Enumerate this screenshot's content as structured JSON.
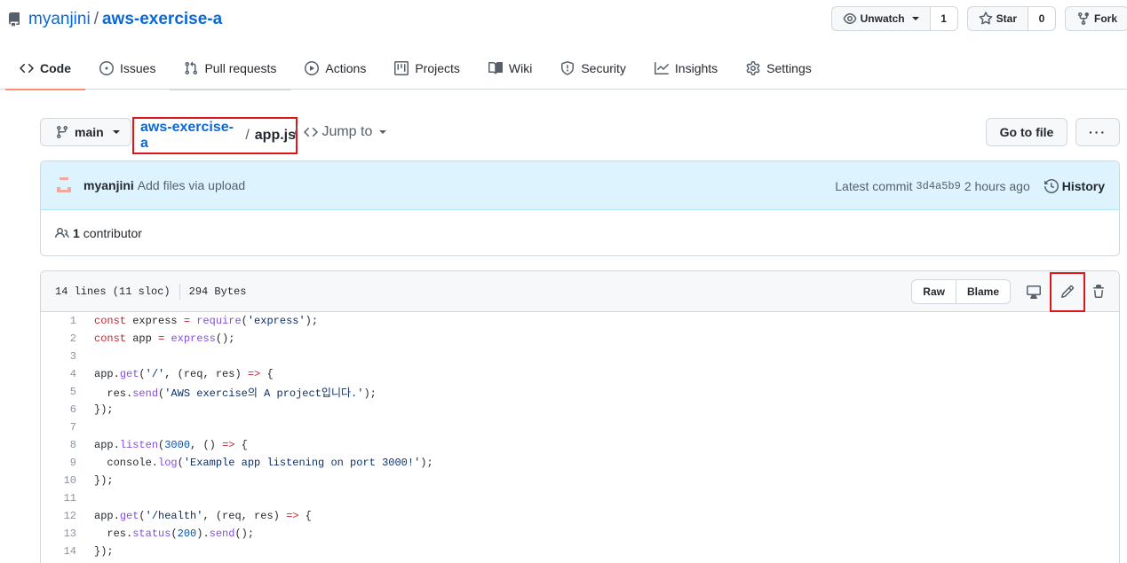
{
  "repo": {
    "owner": "myanjini",
    "separator": "/",
    "name": "aws-exercise-a"
  },
  "repo_actions": {
    "watch": {
      "label": "Unwatch",
      "count": "1"
    },
    "star": {
      "label": "Star",
      "count": "0"
    },
    "fork": {
      "label": "Fork"
    }
  },
  "tabs": [
    {
      "label": "Code",
      "icon": "code-icon"
    },
    {
      "label": "Issues",
      "icon": "issue-icon"
    },
    {
      "label": "Pull requests",
      "icon": "pull-request-icon"
    },
    {
      "label": "Actions",
      "icon": "play-icon"
    },
    {
      "label": "Projects",
      "icon": "project-icon"
    },
    {
      "label": "Wiki",
      "icon": "book-icon"
    },
    {
      "label": "Security",
      "icon": "shield-icon"
    },
    {
      "label": "Insights",
      "icon": "graph-icon"
    },
    {
      "label": "Settings",
      "icon": "gear-icon"
    }
  ],
  "file_nav": {
    "branch": "main",
    "breadcrumb_root": "aws-exercise-a",
    "breadcrumb_sep": "/",
    "file_name": "app.js",
    "jump_sep": "/",
    "jump_label": "Jump to",
    "go_to_file": "Go to file",
    "more": "···"
  },
  "commit": {
    "author": "myanjini",
    "message": "Add files via upload",
    "latest_label": "Latest commit",
    "sha": "3d4a5b9",
    "time": "2 hours ago",
    "history_label": "History",
    "contributors_count": "1",
    "contributors_label": "contributor"
  },
  "file": {
    "lines_info": "14 lines (11 sloc)",
    "size": "294 Bytes",
    "raw_label": "Raw",
    "blame_label": "Blame"
  },
  "code_lines": [
    "const express = require('express');",
    "const app = express();",
    "",
    "app.get('/', (req, res) => {",
    "  res.send('AWS exercise의 A project입니다.');",
    "});",
    "",
    "app.listen(3000, () => {",
    "  console.log('Example app listening on port 3000!');",
    "});",
    "",
    "app.get('/health', (req, res) => {",
    "  res.status(200).send();",
    "});"
  ],
  "colors": {
    "link": "#0969da",
    "tab_underline": "#fd8c73",
    "highlight_box": "#e0141b",
    "commit_bg": "#ddf4ff"
  }
}
